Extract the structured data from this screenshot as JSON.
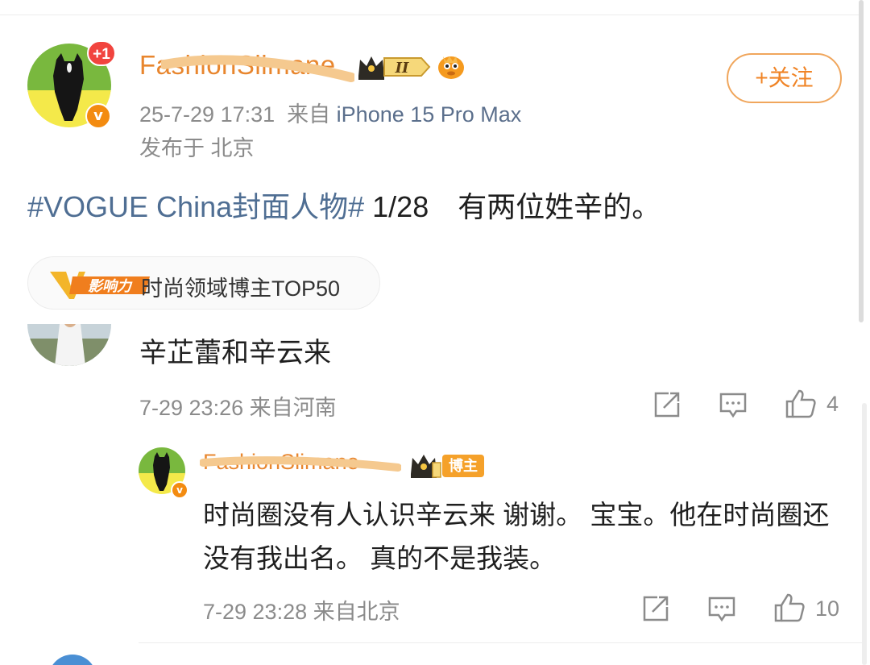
{
  "post": {
    "author": {
      "name": "FashionSlimane",
      "notification_badge": "+1",
      "verified_mark": "v",
      "crown_level": "II"
    },
    "follow_label": "+关注",
    "timestamp": "25-7-29 17:31",
    "source_prefix": "来自",
    "device": "iPhone 15 Pro Max",
    "location": "发布于 北京",
    "hashtag": "#VOGUE China封面人物#",
    "body": " 1/28　有两位姓辛的。",
    "influence": {
      "badge_text": "影响力",
      "label": "时尚领域博主TOP50"
    }
  },
  "comment": {
    "text": "辛芷蕾和辛云来",
    "meta": "7-29 23:26 来自河南",
    "like_count": "4",
    "reply": {
      "author": "FashionSlimane",
      "role_tag": "博主",
      "verified_mark": "v",
      "text": "时尚圈没有人认识辛云来 谢谢。 宝宝。他在时尚圈还没有我出名。 真的不是我装。",
      "meta": "7-29 23:28 来自北京",
      "like_count": "10"
    }
  },
  "icons": [
    "share-icon",
    "comment-icon",
    "like-icon"
  ],
  "colors": {
    "username": "#e8862e",
    "hashtag": "#4f6e93",
    "follow_border": "#f0a65c",
    "meta_gray": "#8b8b8b",
    "notify_red": "#f1443e",
    "verified_orange": "#f38b10"
  }
}
